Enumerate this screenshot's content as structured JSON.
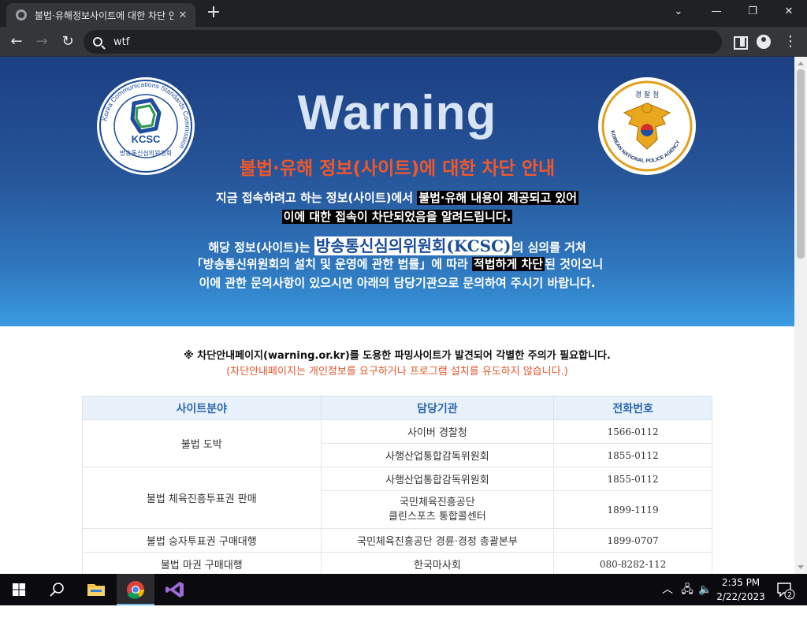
{
  "browser": {
    "tab_title": "불법·유해정보사이트에 대한 차단 안내",
    "tab_close": "✕",
    "new_tab": "+",
    "window_controls": {
      "minimize": "⌄",
      "minimize2": "—",
      "restore": "❐",
      "close": "✕"
    },
    "address": "wtf",
    "nav": {
      "back": "←",
      "forward": "→",
      "reload": "↻"
    },
    "menu": "⋮"
  },
  "page": {
    "title": "Warning",
    "subtitle": "불법·유해 정보(사이트)에 대한 차단 안내",
    "line1_a": "지금 접속하려고 하는 정보(사이트)에서 ",
    "line1_b": "불법·유해 내용이 제공되고 있어",
    "line2": "이에 대한 접속이 차단되었음을 알려드립니다.",
    "line3_a": "해당 정보(사이트)는 ",
    "line3_b": "방송통신심의위원회(KCSC)",
    "line3_c": "의 심의를 거쳐",
    "line4_a": "「방송통신위원회의 설치 및 운영에 관한 법률」에 따라 ",
    "line4_b": "적법하게 차단",
    "line4_c": "된 것이오니",
    "line5": "이에 관한 문의사항이 있으시면 아래의 담당기관으로 문의하여 주시기 바랍니다.",
    "notice1": "※ 차단안내페이지(warning.or.kr)를 도용한 파밍사이트가 발견되어 각별한 주의가 필요합니다.",
    "notice2": "(차단안내페이지는 개인정보를 요구하거나 프로그램 설치를 유도하지 않습니다.)",
    "logos": {
      "left": {
        "ring_text": "Korea Communications Standards Commission",
        "abbr": "KCSC",
        "korean": "방송통신심의위원회"
      },
      "right": {
        "top_text": "경 찰 청",
        "ring_text": "KOREAN NATIONAL POLICE AGENCY"
      }
    }
  },
  "table": {
    "headers": [
      "사이트분야",
      "담당기관",
      "전화번호"
    ],
    "groups": [
      {
        "field": "불법 도박",
        "rows": [
          {
            "agency": "사이버 경찰청",
            "phone": "1566-0112"
          },
          {
            "agency": "사행산업통합감독위원회",
            "phone": "1855-0112"
          }
        ]
      },
      {
        "field": "불법 체육진흥투표권 판매",
        "rows": [
          {
            "agency": "사행산업통합감독위원회",
            "phone": "1855-0112"
          },
          {
            "agency": "국민체육진흥공단\n클린스포츠 통합콜센터",
            "phone": "1899-1119"
          }
        ]
      },
      {
        "field": "불법 승자투표권 구매대행",
        "rows": [
          {
            "agency": "국민체육진흥공단 경륜·경정 총괄본부",
            "phone": "1899-0707"
          }
        ]
      },
      {
        "field": "불법 마권 구매대행",
        "rows": [
          {
            "agency": "한국마사회",
            "phone": "080-8282-112"
          }
        ]
      }
    ]
  },
  "taskbar": {
    "apps": [
      "windows-start",
      "search",
      "file-explorer",
      "chrome",
      "visual-studio"
    ],
    "tray": {
      "chevron": "︿",
      "network": "🖧",
      "volume": "🔈"
    },
    "clock_time": "2:35 PM",
    "clock_date": "2/22/2023",
    "notifications": "2"
  },
  "colors": {
    "banner_top": "#1b3f82",
    "banner_bottom": "#3a9be0",
    "subtitle": "#f0582a",
    "table_header": "#2a68ae",
    "notice_red": "#e2562c"
  }
}
